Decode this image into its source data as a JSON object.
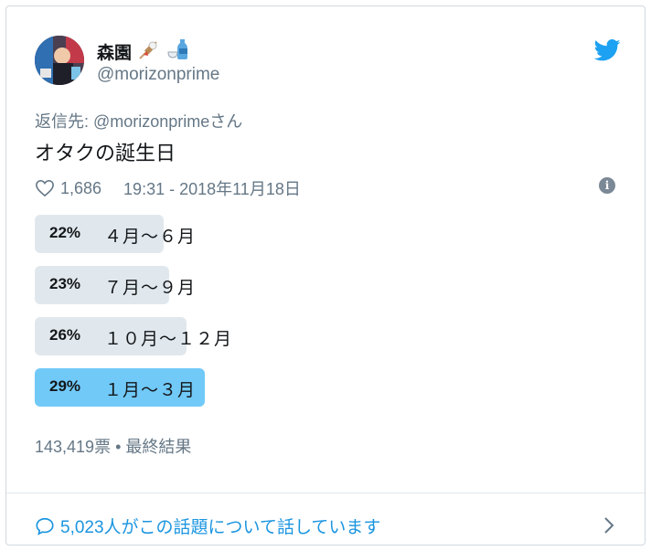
{
  "tweet": {
    "display_name": "森園",
    "emojis": [
      "oden-icon",
      "sake-icon"
    ],
    "handle": "@morizonprime",
    "reply_to": "返信先: @morizonprimeさん",
    "text": "オタクの誕生日",
    "likes": "1,686",
    "timestamp": "19:31 - 2018年11月18日"
  },
  "poll": {
    "options": [
      {
        "percent_label": "22%",
        "label": "４月～６月",
        "percent": 22,
        "winner": false
      },
      {
        "percent_label": "23%",
        "label": "７月～９月",
        "percent": 23,
        "winner": false
      },
      {
        "percent_label": "26%",
        "label": "１０月～１２月",
        "percent": 26,
        "winner": false
      },
      {
        "percent_label": "29%",
        "label": "１月～３月",
        "percent": 29,
        "winner": true
      }
    ],
    "summary": "143,419票 • 最終結果"
  },
  "footer": {
    "conversation": "5,023人がこの話題について話しています"
  },
  "colors": {
    "accent": "#1b95e0",
    "bird": "#1da1f2",
    "winner_bar": "#71c9f8",
    "bar": "#e1e8ed",
    "muted": "#657786"
  }
}
